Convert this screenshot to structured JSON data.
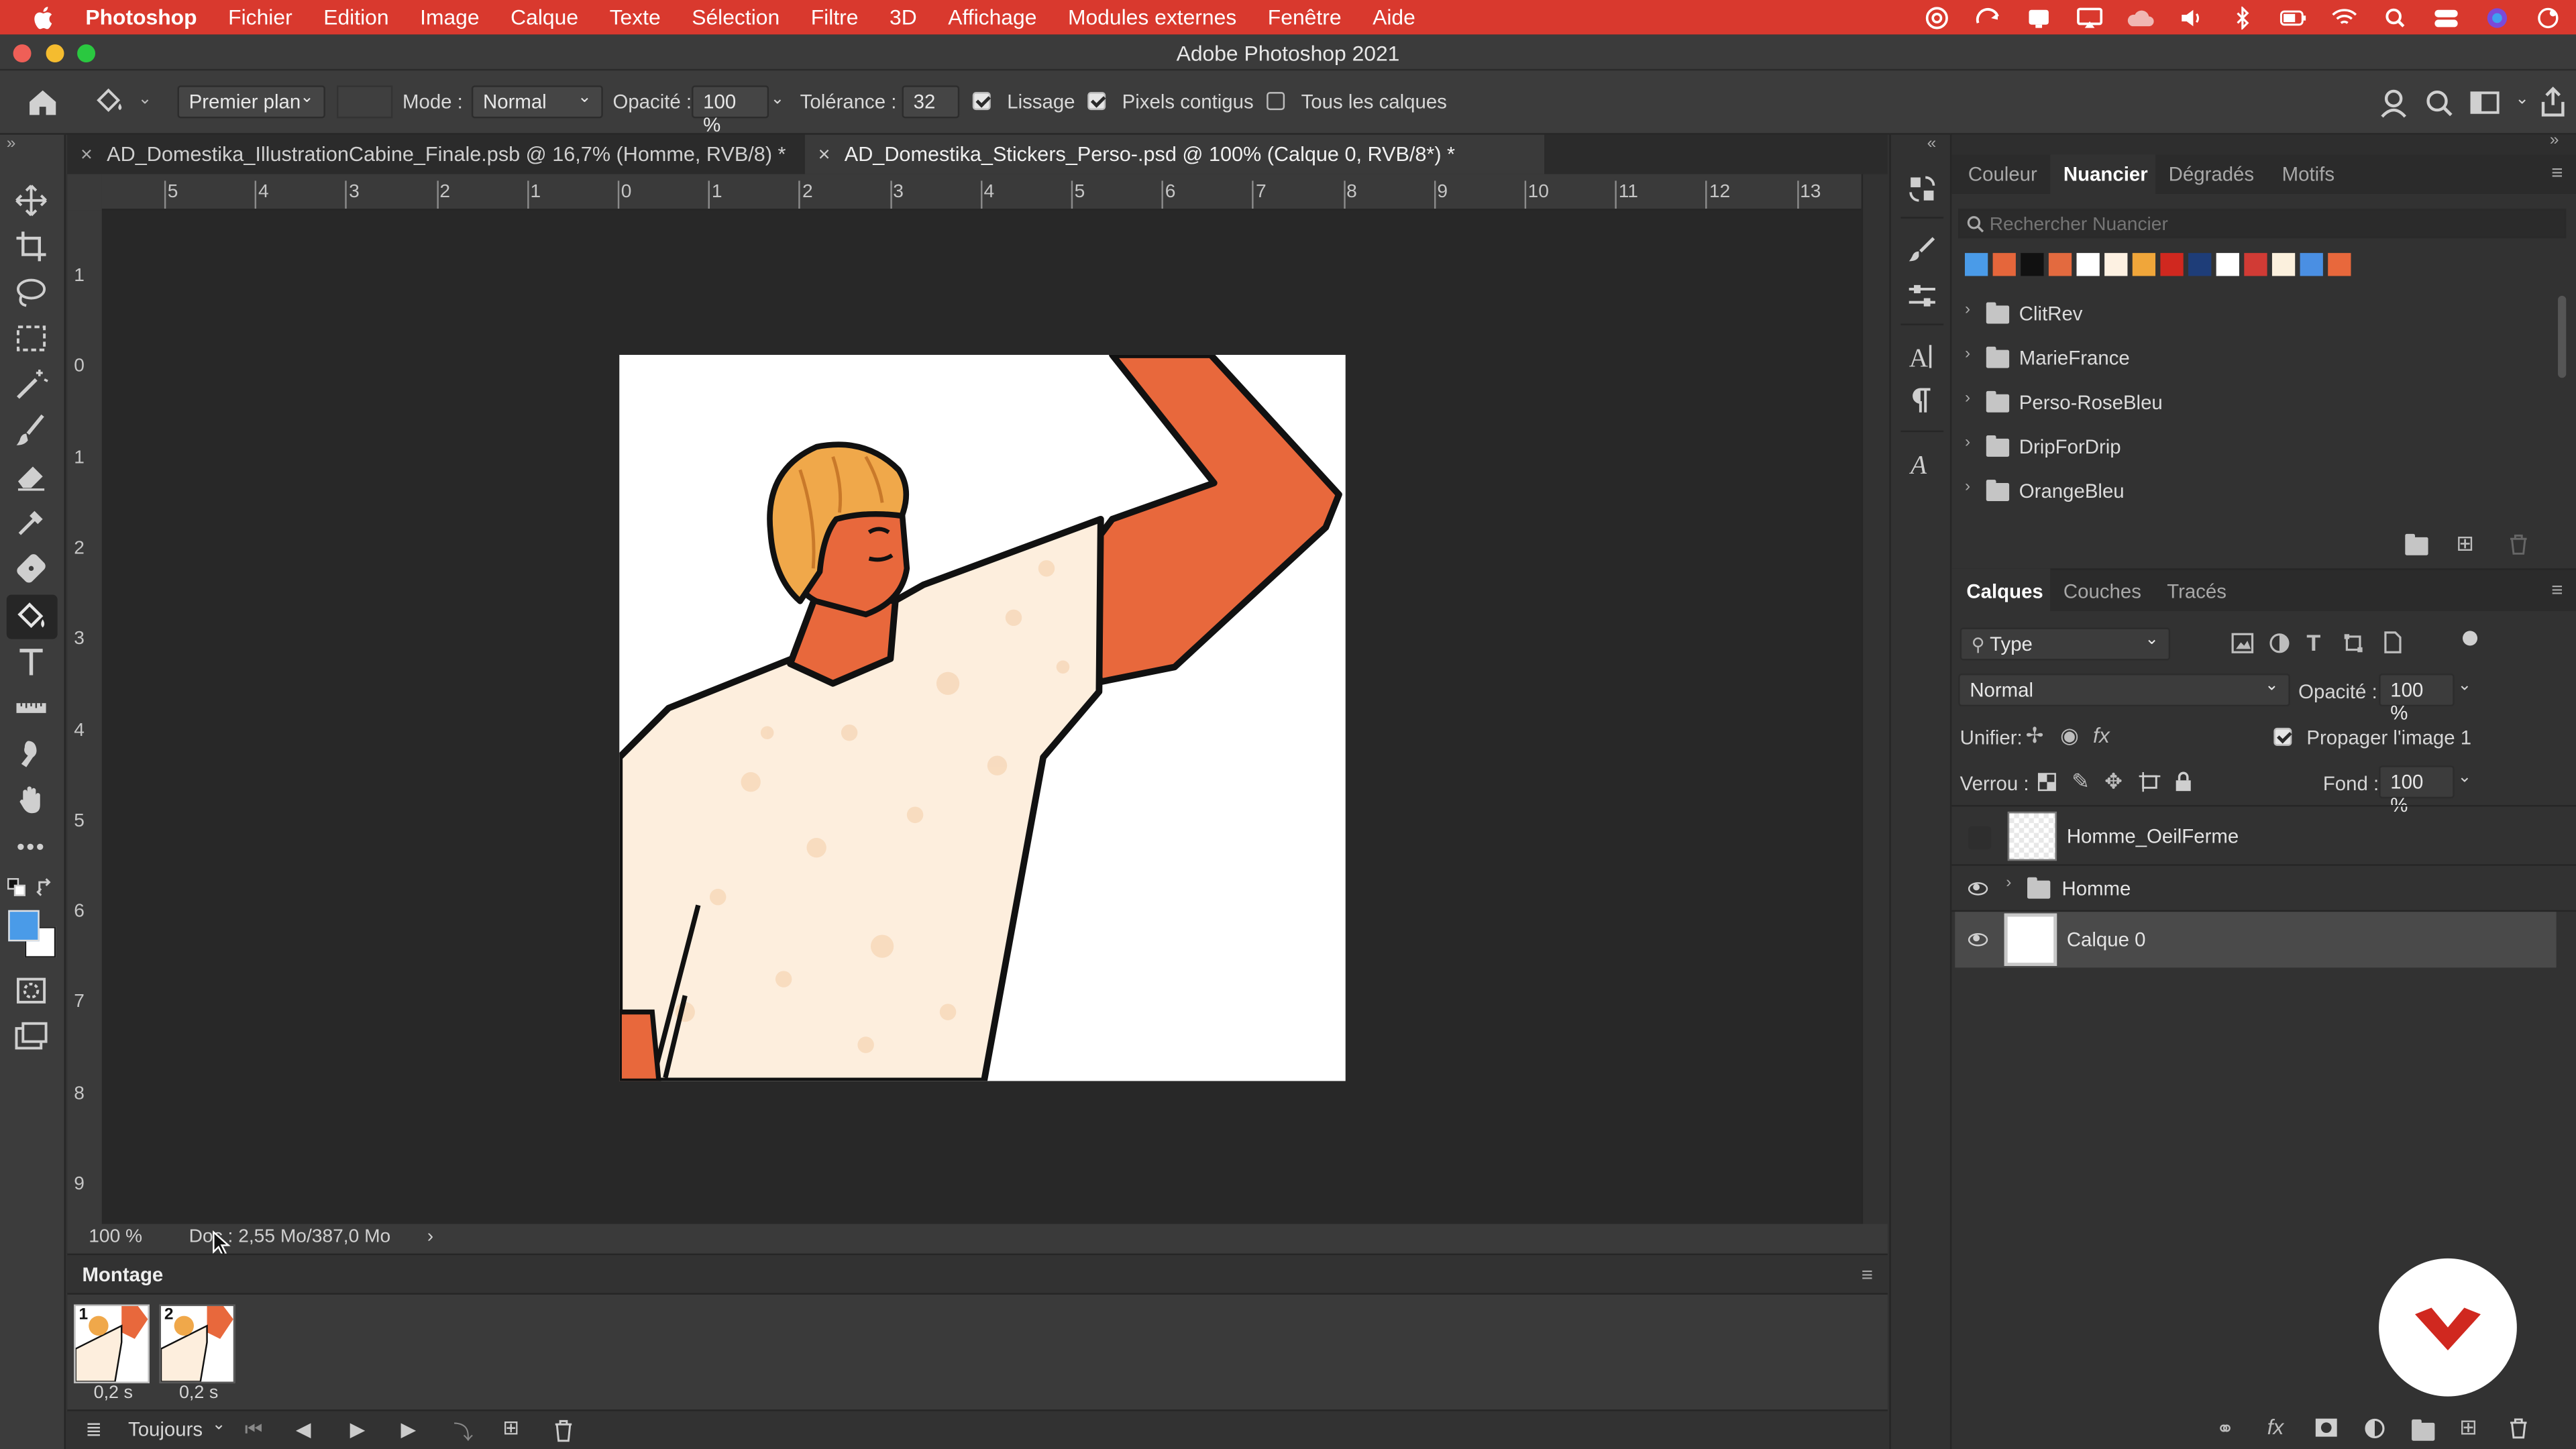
{
  "menubar": {
    "app_name": "Photoshop",
    "items": [
      "Fichier",
      "Edition",
      "Image",
      "Calque",
      "Texte",
      "Sélection",
      "Filtre",
      "3D",
      "Affichage",
      "Modules externes",
      "Fenêtre",
      "Aide"
    ]
  },
  "window": {
    "title": "Adobe Photoshop 2021"
  },
  "options": {
    "fill_source": "Premier plan",
    "mode_label": "Mode :",
    "mode_value": "Normal",
    "opacity_label": "Opacité :",
    "opacity_value": "100 %",
    "tolerance_label": "Tolérance :",
    "tolerance_value": "32",
    "antialias_label": "Lissage",
    "antialias_checked": true,
    "contiguous_label": "Pixels contigus",
    "contiguous_checked": true,
    "all_layers_label": "Tous les calques",
    "all_layers_checked": false
  },
  "tabs": [
    {
      "label": "AD_Domestika_IllustrationCabine_Finale.psb @ 16,7% (Homme, RVB/8) *",
      "active": false
    },
    {
      "label": "AD_Domestika_Stickers_Perso-.psd @ 100% (Calque 0, RVB/8*) *",
      "active": true
    }
  ],
  "rulers": {
    "top": [
      "5",
      "4",
      "3",
      "2",
      "1",
      "0",
      "1",
      "2",
      "3",
      "4",
      "5",
      "6",
      "7",
      "8",
      "9",
      "10",
      "11",
      "12",
      "13"
    ],
    "left": [
      "1",
      "0",
      "1",
      "2",
      "3",
      "4",
      "5",
      "6",
      "7",
      "8",
      "9"
    ]
  },
  "status": {
    "zoom": "100 %",
    "doc_info": "Doc : 2,55 Mo/387,0 Mo",
    "more": "›"
  },
  "timeline": {
    "title": "Montage",
    "frames": [
      {
        "number": "1",
        "delay": "0,2 s"
      },
      {
        "number": "2",
        "delay": "0,2 s"
      }
    ],
    "loop": "Toujours"
  },
  "swatches_panel": {
    "tabs": [
      "Couleur",
      "Nuancier",
      "Dégradés",
      "Motifs"
    ],
    "active_tab": "Nuancier",
    "search_placeholder": "Rechercher Nuancier",
    "colors": [
      "#4a9be8",
      "#e5663b",
      "#111111",
      "#e36a3f",
      "#ffffff",
      "#fdf1e2",
      "#f0a63a",
      "#d0281f",
      "#1e3d78",
      "#ffffff",
      "#d13b35",
      "#fbf0dd",
      "#4a8fe3",
      "#e8683c"
    ],
    "groups": [
      "ClitRev",
      "MarieFrance",
      "Perso-RoseBleu",
      "DripForDrip",
      "OrangeBleu"
    ]
  },
  "layers_panel": {
    "tabs": [
      "Calques",
      "Couches",
      "Tracés"
    ],
    "active_tab": "Calques",
    "filter_label": "Type",
    "blend_mode": "Normal",
    "opacity_label": "Opacité :",
    "opacity_value": "100 %",
    "unify_label": "Unifier:",
    "propagate_label": "Propager l'image 1",
    "propagate_checked": true,
    "lock_label": "Verrou :",
    "fill_label": "Fond :",
    "fill_value": "100 %",
    "layers": [
      {
        "name": "Homme_OeilFerme",
        "visible": false,
        "kind": "pixel"
      },
      {
        "name": "Homme",
        "visible": true,
        "kind": "group"
      },
      {
        "name": "Calque 0",
        "visible": true,
        "kind": "pixel",
        "selected": true
      }
    ]
  },
  "colors": {
    "menubar": "#d9392e",
    "foreground": "#4a9be8",
    "background": "#ffffff",
    "skin": "#e8683c",
    "shirt": "#fdeedd",
    "hair": "#f0a84a",
    "domestika": "#d0281f"
  }
}
